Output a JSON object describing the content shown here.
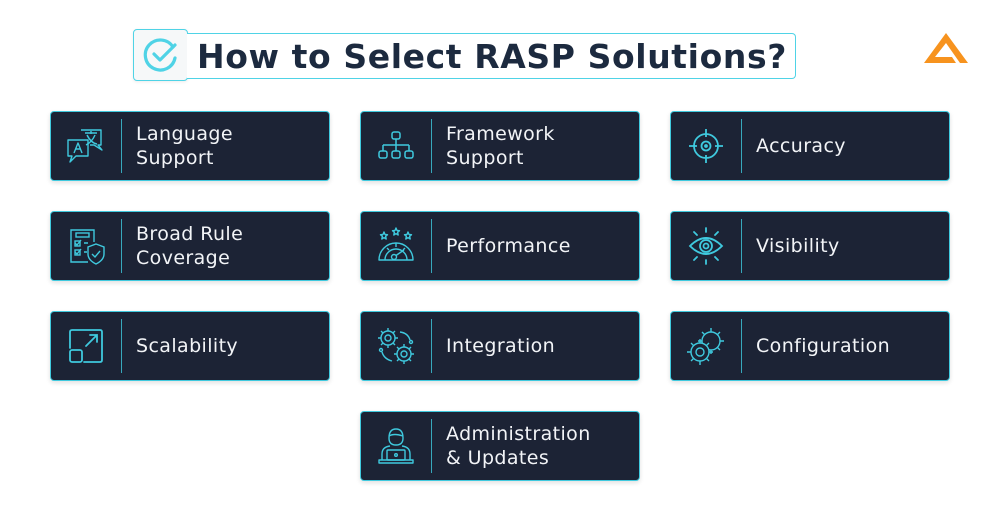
{
  "header": {
    "title": "How to Select RASP Solutions?",
    "title_icon": "check-circle-icon",
    "logo_icon": "triangle-logo-icon"
  },
  "colors": {
    "accent": "#3fc9de",
    "card_bg": "#1c2335",
    "title_text": "#1c2a3f",
    "logo": "#f7931e",
    "card_text": "#f2f4f7"
  },
  "cards": [
    {
      "line1": "Language",
      "line2": "Support",
      "icon": "translate-icon"
    },
    {
      "line1": "Framework",
      "line2": "Support",
      "icon": "hierarchy-icon"
    },
    {
      "line1": "Accuracy",
      "line2": "",
      "icon": "target-icon"
    },
    {
      "line1": "Broad Rule",
      "line2": "Coverage",
      "icon": "checklist-shield-icon"
    },
    {
      "line1": "Performance",
      "line2": "",
      "icon": "speedometer-stars-icon"
    },
    {
      "line1": "Visibility",
      "line2": "",
      "icon": "eye-icon"
    },
    {
      "line1": "Scalability",
      "line2": "",
      "icon": "scale-up-icon"
    },
    {
      "line1": "Integration",
      "line2": "",
      "icon": "gears-icon"
    },
    {
      "line1": "Configuration",
      "line2": "",
      "icon": "gear-config-icon"
    },
    {
      "line1": "Administration",
      "line2": "& Updates",
      "icon": "admin-laptop-icon"
    }
  ]
}
